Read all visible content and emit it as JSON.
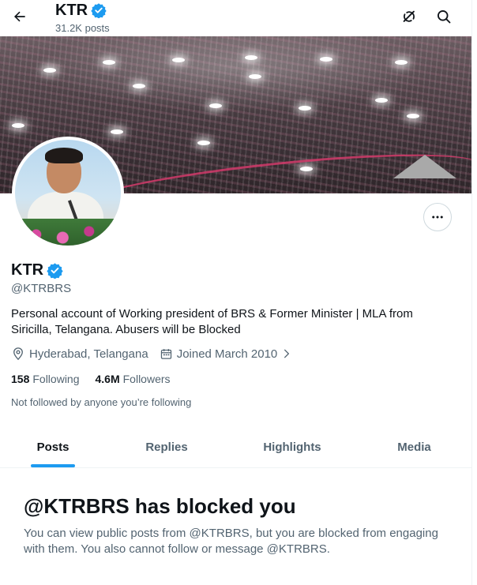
{
  "header": {
    "name": "KTR",
    "posts_count": "31.2K posts"
  },
  "icons": {
    "back": "arrow-left-icon",
    "grok": "grok-icon",
    "search": "search-icon",
    "verified": "verified-badge-icon",
    "more": "more-icon",
    "location": "location-icon",
    "calendar": "calendar-icon"
  },
  "colors": {
    "accent": "#1d9bf0",
    "text_primary": "#0f1419",
    "text_secondary": "#536471"
  },
  "profile": {
    "name": "KTR",
    "handle": "@KTRBRS",
    "bio": "Personal account of Working president of BRS & Former Minister | MLA from Siricilla, Telangana. Abusers will be Blocked",
    "location": "Hyderabad, Telangana",
    "joined": "Joined March 2010",
    "following_count": "158",
    "following_label": "Following",
    "followers_count": "4.6M",
    "followers_label": "Followers",
    "not_followed": "Not followed by anyone you’re following"
  },
  "tabs": [
    {
      "label": "Posts",
      "active": true
    },
    {
      "label": "Replies",
      "active": false
    },
    {
      "label": "Highlights",
      "active": false
    },
    {
      "label": "Media",
      "active": false
    }
  ],
  "blocked": {
    "title": "@KTRBRS has blocked you",
    "description": "You can view public posts from @KTRBRS, but you are blocked from engaging with them. You also cannot follow or message @KTRBRS."
  }
}
